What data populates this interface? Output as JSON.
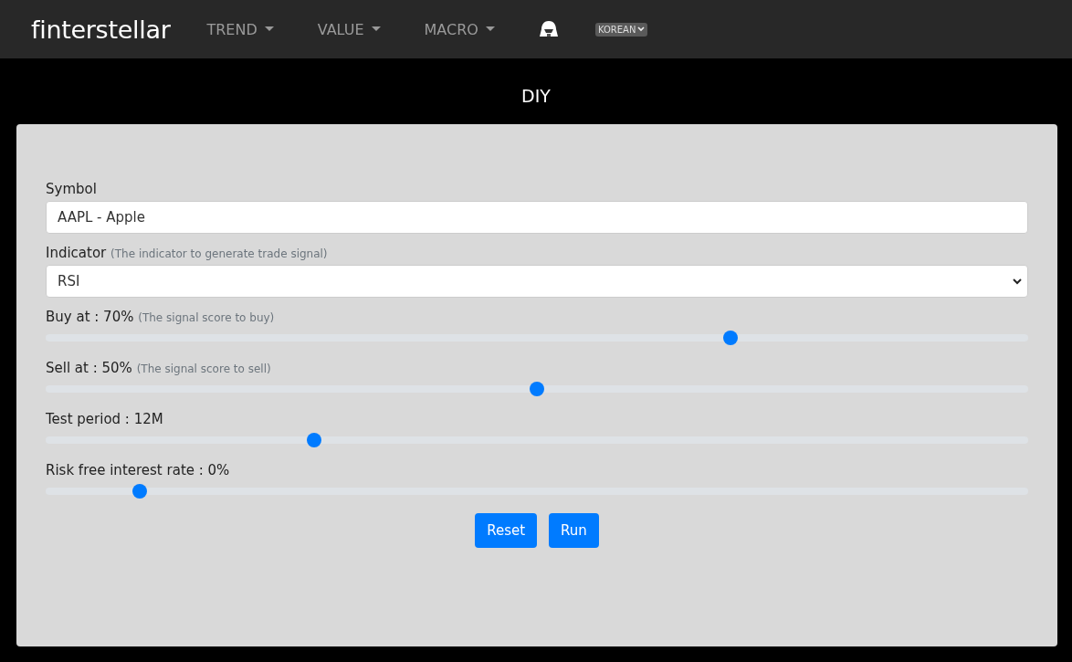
{
  "navbar": {
    "brand": "finterstellar",
    "menus": [
      {
        "label": "TREND"
      },
      {
        "label": "VALUE"
      },
      {
        "label": "MACRO"
      }
    ],
    "language": "KOREAN"
  },
  "page_title": "DIY",
  "form": {
    "symbol": {
      "label": "Symbol",
      "value": "AAPL - Apple"
    },
    "indicator": {
      "label": "Indicator",
      "hint": "(The indicator to generate trade signal)",
      "value": "RSI"
    },
    "sliders": [
      {
        "label": "Buy at : 70%",
        "hint": "(The signal score to buy)",
        "level": 0.7
      },
      {
        "label": "Sell at : 50%",
        "hint": "(The signal score to sell)",
        "level": 0.5
      },
      {
        "label": "Test period : 12M",
        "level": 0.27
      },
      {
        "label": "Risk free interest rate : 0%",
        "level": 0.09
      }
    ],
    "buttons": [
      "Reset",
      "Run"
    ]
  }
}
